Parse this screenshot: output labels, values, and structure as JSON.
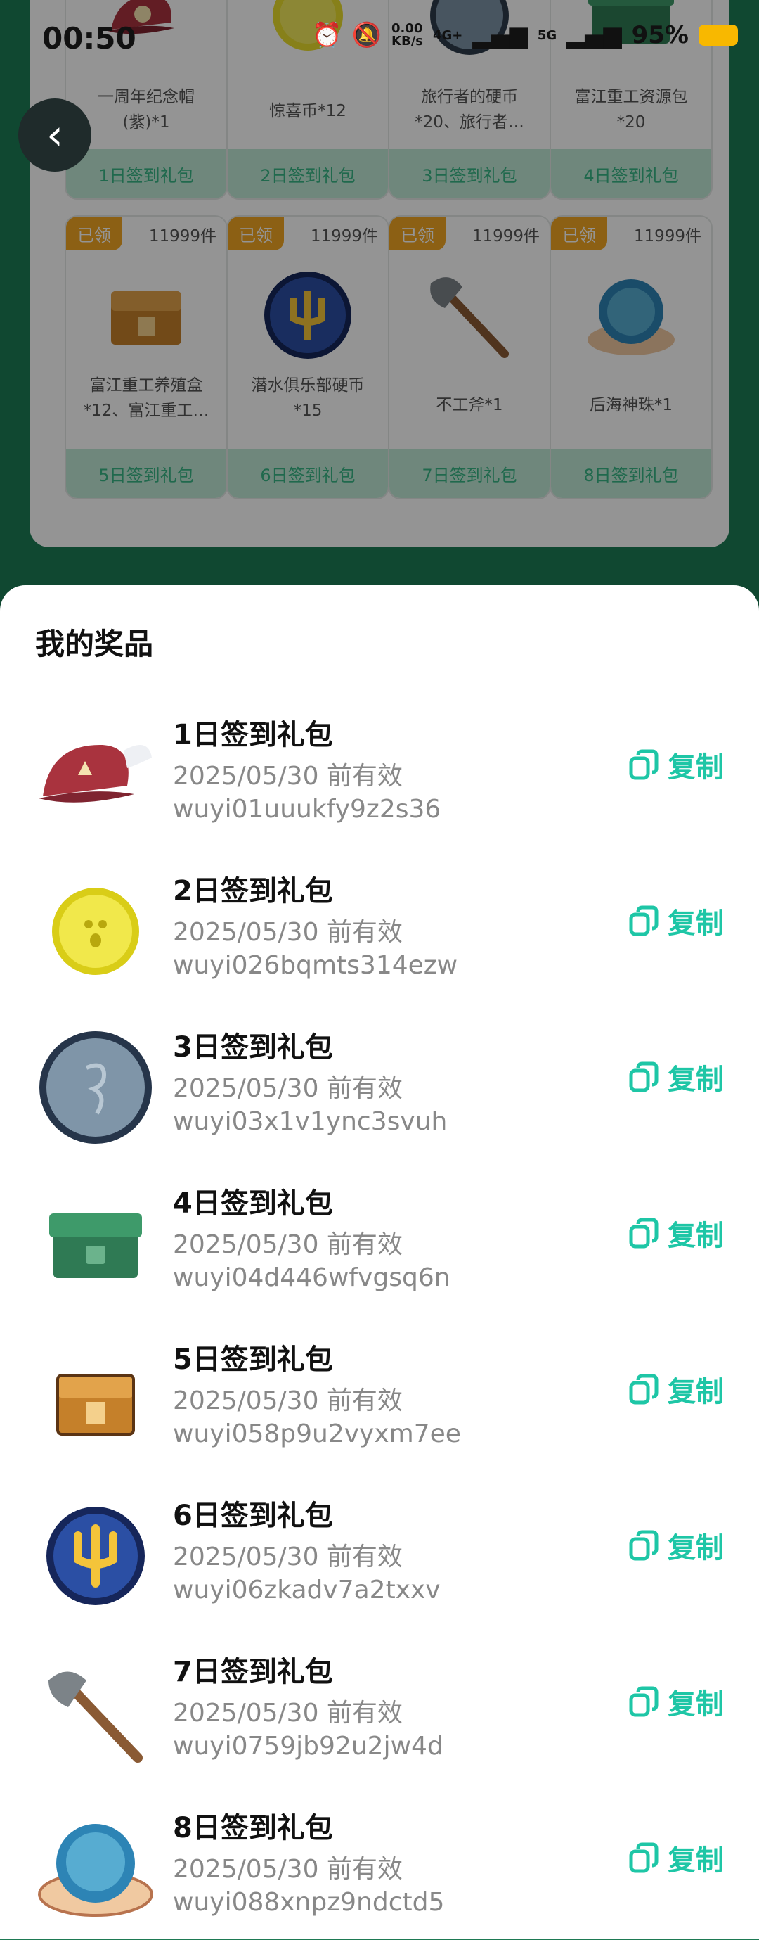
{
  "status_bar": {
    "time": "00:50",
    "net_speed": "0.00\nKB/s",
    "net_type1": "4G+",
    "net_type2": "5G",
    "battery": "95%"
  },
  "cards": [
    {
      "name": "一周年纪念帽\n(紫)*1",
      "button": "1日签到礼包",
      "icon": "cap-icon"
    },
    {
      "name": "惊喜币*12",
      "button": "2日签到礼包",
      "icon": "coin-icon"
    },
    {
      "name": "旅行者的硬币\n*20、旅行者…",
      "button": "3日签到礼包",
      "icon": "silver-coin-icon"
    },
    {
      "name": "富江重工资源包\n*20",
      "button": "4日签到礼包",
      "icon": "green-box-icon"
    },
    {
      "name": "富江重工养殖盒\n*12、富江重工…",
      "button": "5日签到礼包",
      "tag": "已领",
      "count": "11999件",
      "icon": "chest-icon"
    },
    {
      "name": "潜水俱乐部硬币\n*15",
      "button": "6日签到礼包",
      "tag": "已领",
      "count": "11999件",
      "icon": "trident-coin-icon"
    },
    {
      "name": "不工斧*1",
      "button": "7日签到礼包",
      "tag": "已领",
      "count": "11999件",
      "icon": "axe-icon"
    },
    {
      "name": "后海神珠*1",
      "button": "8日签到礼包",
      "tag": "已领",
      "count": "11999件",
      "icon": "pearl-icon"
    }
  ],
  "sheet": {
    "title": "我的奖品",
    "copy_label": "复制",
    "items": [
      {
        "title": "1日签到礼包",
        "expiry": "2025/05/30 前有效",
        "code": "wuyi01uuukfy9z2s36",
        "icon": "cap-icon"
      },
      {
        "title": "2日签到礼包",
        "expiry": "2025/05/30 前有效",
        "code": "wuyi026bqmts314ezw",
        "icon": "coin-icon"
      },
      {
        "title": "3日签到礼包",
        "expiry": "2025/05/30 前有效",
        "code": "wuyi03x1v1ync3svuh",
        "icon": "silver-coin-icon"
      },
      {
        "title": "4日签到礼包",
        "expiry": "2025/05/30 前有效",
        "code": "wuyi04d446wfvgsq6n",
        "icon": "green-box-icon"
      },
      {
        "title": "5日签到礼包",
        "expiry": "2025/05/30 前有效",
        "code": "wuyi058p9u2vyxm7ee",
        "icon": "chest-icon"
      },
      {
        "title": "6日签到礼包",
        "expiry": "2025/05/30 前有效",
        "code": "wuyi06zkadv7a2txxv",
        "icon": "trident-coin-icon"
      },
      {
        "title": "7日签到礼包",
        "expiry": "2025/05/30 前有效",
        "code": "wuyi0759jb92u2jw4d",
        "icon": "axe-icon"
      },
      {
        "title": "8日签到礼包",
        "expiry": "2025/05/30 前有效",
        "code": "wuyi088xnpz9ndctd5",
        "icon": "pearl-icon"
      }
    ]
  },
  "colors": {
    "accent": "#1ec6a6",
    "header_green": "#1d7d55",
    "tag_orange": "#f2a623"
  }
}
